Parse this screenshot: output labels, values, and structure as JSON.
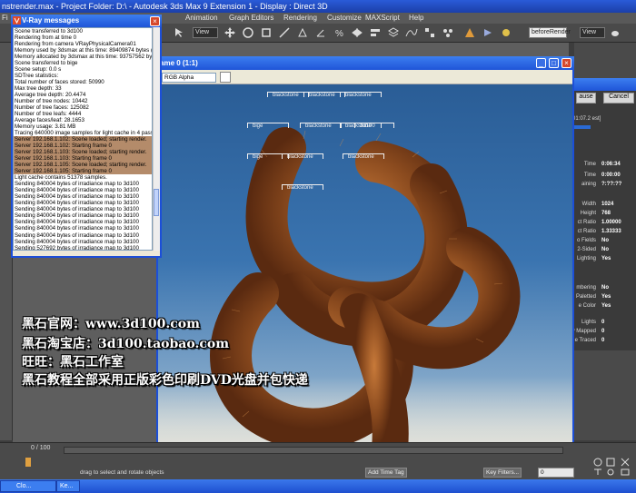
{
  "app": {
    "title": "nstrender.max     -  Project Folder: D:\\          -  Autodesk 3ds Max 9 Extension 1          -  Display : Direct 3D",
    "menu": [
      "Fi",
      "actor",
      "Animation",
      "Graph Editors",
      "Rendering",
      "Customize",
      "MAXScript",
      "Help"
    ],
    "toolbar": {
      "view_label_1": "View",
      "view_label_2": "View",
      "named_selection": "beforeRender"
    }
  },
  "vray_window": {
    "title": "V-Ray messages",
    "lines": [
      {
        "text": "Scene transferred to 3d100",
        "highlight": false
      },
      {
        "text": "Rendering from at time 0",
        "highlight": false
      },
      {
        "text": "Rendering from camera VRayPhysicalCamera01",
        "highlight": false
      },
      {
        "text": "Memory used by 3dsmax at this time: 89409874 bytes (85.",
        "highlight": false
      },
      {
        "text": "Memory allocated by 3dsmax at this time: 93757562 bytes",
        "highlight": false
      },
      {
        "text": "Scene transferred to bige",
        "highlight": false
      },
      {
        "text": "Scene setup: 0.0 s",
        "highlight": false
      },
      {
        "text": "SDTree statistics:",
        "highlight": false
      },
      {
        "text": "Total number of faces stored: 50990",
        "highlight": false
      },
      {
        "text": "Max tree depth: 33",
        "highlight": false
      },
      {
        "text": "Average tree depth: 20.4474",
        "highlight": false
      },
      {
        "text": "Number of tree nodes: 10442",
        "highlight": false
      },
      {
        "text": "Number of tree faces: 125082",
        "highlight": false
      },
      {
        "text": "Number of tree leafs: 4444",
        "highlight": false
      },
      {
        "text": "Average faces/leaf: 28.1653",
        "highlight": false
      },
      {
        "text": "Memory usage: 3.81 MB",
        "highlight": false
      },
      {
        "text": "Tracing 640000 image samples for light cache in 4 passes.",
        "highlight": false
      },
      {
        "text": "Server 192.168.1.102: Scene loaded; starting render.",
        "highlight": true
      },
      {
        "text": "Server 192.168.1.102: Starting frame 0",
        "highlight": true
      },
      {
        "text": "Server 192.168.1.103: Scene loaded; starting render.",
        "highlight": true
      },
      {
        "text": "Server 192.168.1.103: Starting frame 0",
        "highlight": true
      },
      {
        "text": "Server 192.168.1.105: Scene loaded; starting render.",
        "highlight": true
      },
      {
        "text": "Server 192.168.1.105: Starting frame 0",
        "highlight": true
      },
      {
        "text": "Light cache contains 51378 samples.",
        "highlight": false
      },
      {
        "text": "Sending 840004 bytes of irradiance map to 3d100",
        "highlight": false
      },
      {
        "text": "Sending 840004 bytes of irradiance map to 3d100",
        "highlight": false
      },
      {
        "text": "Sending 840004 bytes of irradiance map to 3d100",
        "highlight": false
      },
      {
        "text": "Sending 840004 bytes of irradiance map to 3d100",
        "highlight": false
      },
      {
        "text": "Sending 840004 bytes of irradiance map to 3d100",
        "highlight": false
      },
      {
        "text": "Sending 840004 bytes of irradiance map to 3d100",
        "highlight": false
      },
      {
        "text": "Sending 840004 bytes of irradiance map to 3d100",
        "highlight": false
      },
      {
        "text": "Sending 840004 bytes of irradiance map to 3d100",
        "highlight": false
      },
      {
        "text": "Sending 840004 bytes of irradiance map to 3d100",
        "highlight": false
      },
      {
        "text": "Sending 840004 bytes of irradiance map to 3d100",
        "highlight": false
      },
      {
        "text": "Sending 527692 bytes of irradiance map to 3d100",
        "highlight": false
      }
    ]
  },
  "frame_buffer": {
    "title": "ame 0 (1:1)",
    "channel": "RGB Alpha",
    "buckets": [
      {
        "label": "blackstone"
      },
      {
        "label": "blackstone"
      },
      {
        "label": "blackstone"
      },
      {
        "label": "bige"
      },
      {
        "label": "blackstone"
      },
      {
        "label": "blackstone"
      },
      {
        "label": "3d100"
      },
      {
        "label": "bige"
      },
      {
        "label": "blackstone"
      },
      {
        "label": "blackstone"
      },
      {
        "label": "blackstone"
      }
    ]
  },
  "render_panel": {
    "cancel_label": "Cancel",
    "pause_label": "ause",
    "est_text": "01:07.2 est]",
    "rows": [
      {
        "label": "Time",
        "value": "0:06:34"
      },
      {
        "label": "Time",
        "value": "0:00:00"
      },
      {
        "label": "aining",
        "value": "?:??:??"
      },
      {
        "label": "Width",
        "value": "1024"
      },
      {
        "label": "Height",
        "value": "768"
      },
      {
        "label": "ct Ratio",
        "value": "1.00000"
      },
      {
        "label": "ct Ratio",
        "value": "1.33333"
      },
      {
        "label": "o Fields",
        "value": "No"
      },
      {
        "label": "2-Sided",
        "value": "No"
      },
      {
        "label": "Lighting",
        "value": "Yes"
      },
      {
        "label": "mbering",
        "value": "No"
      },
      {
        "label": "Paletted",
        "value": "Yes"
      },
      {
        "label": "e Color",
        "value": "Yes"
      },
      {
        "label": "Lights",
        "value": "0"
      },
      {
        "label": "y Mapped",
        "value": "0"
      },
      {
        "label": "e Traced",
        "value": "0"
      }
    ]
  },
  "status": {
    "frame_counter": "0 / 100",
    "hint": "drag to select and rotate objects",
    "add_time_tag": "Add Time Tag",
    "key_filters": "Key Filters...",
    "frame_field": "0"
  },
  "taskbar": {
    "item_1": "Clo...",
    "item_2": "Ke..."
  },
  "watermark": {
    "line_1": "黑石官网：www.3d100.com",
    "line_2": "黑石淘宝店：3d100.taobao.com",
    "line_3": "旺旺：黑石工作室",
    "line_4": "黑石教程全部采用正版彩色印刷DVD光盘并包快递"
  },
  "colors": {
    "xp_blue": "#1f55d8",
    "log_highlight": "#b48b6a",
    "fur_dark": "#5a2a10",
    "fur_light": "#c87a3a"
  }
}
